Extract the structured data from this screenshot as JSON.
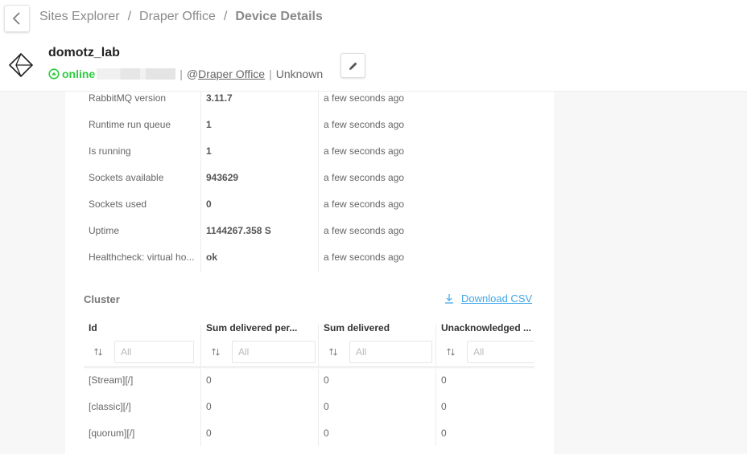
{
  "breadcrumb": {
    "items": [
      "Sites Explorer",
      "Draper Office"
    ],
    "separator": "/",
    "current": "Device Details"
  },
  "device": {
    "name": "domotz_lab",
    "status": "online",
    "site_prefix": "@",
    "site": "Draper Office",
    "type": "Unknown"
  },
  "icons": {
    "back": "chevron-left-icon",
    "device": "device-diamond-icon",
    "status": "online-arrow-icon",
    "edit": "pencil-icon",
    "download": "download-icon",
    "sort": "sort-icon"
  },
  "colors": {
    "online": "#2ecc40",
    "link": "#3ea6e8"
  },
  "metrics": [
    {
      "label": "RabbitMQ version",
      "value": "3.11.7",
      "time": "a few seconds ago"
    },
    {
      "label": "Runtime run queue",
      "value": "1",
      "time": "a few seconds ago"
    },
    {
      "label": "Is running",
      "value": "1",
      "time": "a few seconds ago"
    },
    {
      "label": "Sockets available",
      "value": "943629",
      "time": "a few seconds ago"
    },
    {
      "label": "Sockets used",
      "value": "0",
      "time": "a few seconds ago"
    },
    {
      "label": "Uptime",
      "value": "1144267.358 S",
      "time": "a few seconds ago"
    },
    {
      "label": "Healthcheck: virtual ho...",
      "value": "ok",
      "time": "a few seconds ago"
    }
  ],
  "cluster": {
    "title": "Cluster",
    "download_label": "Download CSV",
    "columns": [
      "Id",
      "Sum delivered per...",
      "Sum delivered",
      "Unacknowledged ..."
    ],
    "filter_placeholder": "All",
    "rows": [
      [
        "[Stream][/]",
        "0",
        "0",
        "0"
      ],
      [
        "[classic][/]",
        "0",
        "0",
        "0"
      ],
      [
        "[quorum][/]",
        "0",
        "0",
        "0"
      ]
    ]
  }
}
